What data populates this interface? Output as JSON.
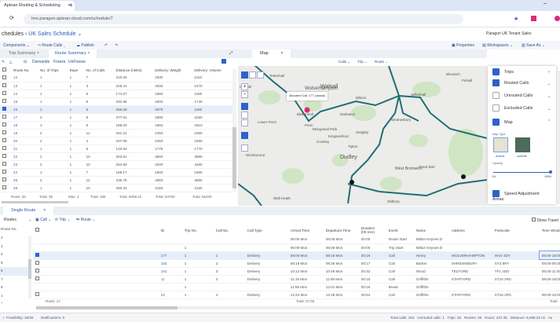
{
  "browser": {
    "tab_title": "Aptean Routing & Scheduling",
    "url": "hns.paragon.aptean.cloud.com/schedule/7"
  },
  "breadcrumb": {
    "parent": "chedules",
    "current": "UK Sales Schedule",
    "tenant": "Paragon UK Tenant Sales"
  },
  "toolbar": {
    "components": "Components",
    "route_calls": "Route Calls",
    "publish": "Publish",
    "properties": "Properties",
    "workspaces": "Workspaces",
    "save_as": "Save As"
  },
  "route_summary": {
    "tabs": [
      "Trip Summary",
      "Route Summary"
    ],
    "actions": [
      "Dismantle",
      "Freeze",
      "UnFreeze"
    ],
    "columns": [
      "Route No.",
      "No. of Trips",
      "Days",
      "No. of Calls",
      "Distance (miles)",
      "Delivery: Weight",
      "Delivery: Volume"
    ],
    "rows": [
      [
        "12",
        "1",
        "1",
        "7",
        "219.26",
        "1930",
        "2110"
      ],
      [
        "13",
        "1",
        "1",
        "3",
        "225.41",
        "2030",
        "2170"
      ],
      [
        "14",
        "1",
        "1",
        "5",
        "174.07",
        "1950",
        "1160"
      ],
      [
        "15",
        "1",
        "1",
        "8",
        "332.96",
        "1800",
        "1740"
      ],
      [
        "16",
        "1",
        "1",
        "5",
        "256.28",
        "2075",
        "1180"
      ],
      [
        "17",
        "2",
        "1",
        "9",
        "377.51",
        "1890",
        "3160"
      ],
      [
        "18",
        "1",
        "1",
        "5",
        "188.20",
        "1650",
        "1810"
      ],
      [
        "19",
        "2",
        "1",
        "11",
        "261.21",
        "1250",
        "1060"
      ],
      [
        "20",
        "2",
        "1",
        "4",
        "207.08",
        "2450",
        "2480"
      ],
      [
        "21",
        "1",
        "1",
        "6",
        "145.93",
        "1775",
        "1770"
      ],
      [
        "22",
        "2",
        "1",
        "10",
        "303.91",
        "3920",
        "3990"
      ],
      [
        "23",
        "2",
        "1",
        "10",
        "254.80",
        "4200",
        "4460"
      ],
      [
        "24",
        "1",
        "1",
        "7",
        "185.17",
        "1600",
        "1650"
      ],
      [
        "25",
        "2",
        "1",
        "12",
        "236.78",
        "4060",
        "4560"
      ],
      [
        "26",
        "1",
        "1",
        "10",
        "250.43",
        "2150",
        "2160"
      ]
    ],
    "selected_route": "16",
    "footer": [
      "Rows: 26",
      "Total: 35",
      "Max: 1",
      "Total: 186",
      "Total: 6008.22",
      "Total: 64700",
      "Total: 66420"
    ]
  },
  "map": {
    "tab": "Map",
    "filters": [
      "Calls",
      "Trip",
      "Route"
    ],
    "tooltip": "Allocated Call: 177 (vassal)",
    "labels": [
      "Tettenhall",
      "Wolverhampton",
      "Walsall",
      "Willenhall",
      "Bilston",
      "Darlaston",
      "Wednesbury",
      "Sedgley",
      "Tipton",
      "Coseley",
      "Dudley",
      "West Bromwich",
      "Great Barr",
      "Codsall",
      "Pelsall",
      "Bloxwich",
      "Oldbury",
      "Wall Heath",
      "Kingswinford",
      "Penn",
      "Lower Penn",
      "Wombourne",
      "Ettingshall Park",
      "Blakenhall",
      "Oldbury"
    ]
  },
  "right_panel": {
    "items": [
      "Trips",
      "Routed Calls",
      "Unrouted Calls",
      "Excluded Calls",
      "Map"
    ],
    "map_type_label": "Map Type",
    "map_types": [
      "default",
      "satellite"
    ],
    "opacity_label": "Opacity",
    "opacity_min": "1%",
    "opacity_max": "100%",
    "opacity_value": 100,
    "speed": "Speed Adjustment Areas"
  },
  "single_route": {
    "tab": "Single Route",
    "route_select": "Routes",
    "actions": [
      "Call",
      "Trip",
      "Route"
    ],
    "show_travel": "Show Travel",
    "route_list_header": "Route No.",
    "route_list": [
      "2",
      "3",
      "4",
      "5",
      "6",
      "7",
      "8",
      "1",
      "4"
    ],
    "columns": [
      "ID",
      "Trip No.",
      "Call No.",
      "Call Type",
      "Arrival Time",
      "Departure Time",
      "Duration (hh:mm)",
      "Event",
      "Name",
      "Address",
      "Postcode",
      "Time Window Used",
      "Weight"
    ],
    "rows": [
      {
        "cb": false,
        "show_cb": false,
        "c": [
          "",
          "",
          "",
          "",
          "06:05 Mon",
          "06:05 Mon",
          "00:00",
          "Route Start",
          "Milton Keynes D",
          "",
          "",
          "",
          ""
        ]
      },
      {
        "cb": false,
        "show_cb": false,
        "c": [
          "",
          "1",
          "",
          "",
          "06:09 Mon",
          "06:09 Mon",
          "00:00",
          "Trip Start",
          "Milton Keynes D",
          "",
          "",
          "",
          ""
        ]
      },
      {
        "cb": true,
        "show_cb": true,
        "c": [
          "177",
          "1",
          "1",
          "Delivery",
          "08:00 Mon",
          "08:19 Mon",
          "00:19",
          "Call",
          "Henry",
          "WOLVERHAMPTON",
          "WV2 4DY",
          "08:00-18:00",
          "480"
        ]
      },
      {
        "cb": false,
        "show_cb": true,
        "c": [
          "153",
          "1",
          "2",
          "Delivery",
          "09:19 Mon",
          "09:36 Mon",
          "00:17",
          "Call",
          "Barber",
          "SHREWSBURY",
          "SY3 8RY",
          "08:00-09:30",
          "500"
        ]
      },
      {
        "cb": false,
        "show_cb": true,
        "c": [
          "181",
          "1",
          "3",
          "Delivery",
          "10:12 Mon",
          "10:46 Mon",
          "00:32",
          "Call",
          "Wood",
          "TELFORD",
          "TF1 2DD",
          "06:00-11:00",
          "300"
        ]
      },
      {
        "cb": false,
        "show_cb": true,
        "c": [
          "11",
          "1",
          "4",
          "Delivery",
          "11:15 Mon",
          "11:59 Mon",
          "00:15",
          "Call",
          "Griffiths",
          "STAFFORD",
          "ST16 2RS",
          "08:00-18:00",
          "185"
        ]
      },
      {
        "cb": false,
        "show_cb": false,
        "c": [
          "",
          "1",
          "",
          "",
          "11:59 Mon",
          "12:01 Mon",
          "00:16",
          "Break",
          "Griffiths",
          "",
          "",
          "",
          ""
        ]
      },
      {
        "cb": false,
        "show_cb": true,
        "c": [
          "22",
          "1",
          "4",
          "Delivery",
          "12:24 Mon",
          "12:28 Mon",
          "00:54",
          "Call",
          "Griffiths",
          "STAFFORD",
          "ST16 2RS",
          "08:00-18:00",
          "185"
        ]
      }
    ],
    "footer_rows": "Rows: 17",
    "footer_total": "Total: 07:55",
    "footer_weight": "Total"
  },
  "status": {
    "left": [
      "Possibility: 26/26",
      "Notifications: 0"
    ],
    "right": "Total calls: 154   Unrouted calls: 1   Trips: 35   Routes: 26   Hours: 237:45   Distance: 6,008.22 mi   Au"
  },
  "colors": {
    "accent": "#2f62c8",
    "route_line": "#1f6f73",
    "marker": "#e0287a"
  }
}
